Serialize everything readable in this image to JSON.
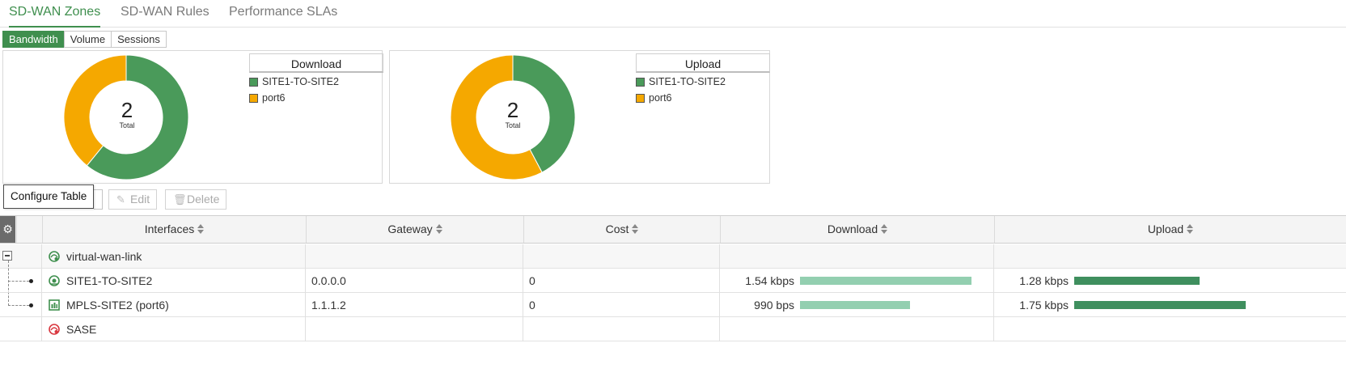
{
  "tabs": [
    {
      "label": "SD-WAN Zones"
    },
    {
      "label": "SD-WAN Rules"
    },
    {
      "label": "Performance SLAs"
    }
  ],
  "modes": [
    {
      "label": "Bandwidth"
    },
    {
      "label": "Volume"
    },
    {
      "label": "Sessions"
    }
  ],
  "colors": {
    "accent": "#3f8f4e",
    "series_green": "#4a9a5a",
    "series_orange": "#f5a800",
    "bar_download": "#93cfb0",
    "bar_upload": "#3f8f5e"
  },
  "charts": {
    "download": {
      "title": "Download",
      "total": "2",
      "total_label": "Total",
      "legend": [
        {
          "name": "SITE1-TO-SITE2",
          "color": "#4a9a5a"
        },
        {
          "name": "port6",
          "color": "#f5a800"
        }
      ]
    },
    "upload": {
      "title": "Upload",
      "total": "2",
      "total_label": "Total",
      "legend": [
        {
          "name": "SITE1-TO-SITE2",
          "color": "#4a9a5a"
        },
        {
          "name": "port6",
          "color": "#f5a800"
        }
      ]
    }
  },
  "chart_data": [
    {
      "type": "pie",
      "title": "Download",
      "categories": [
        "SITE1-TO-SITE2",
        "port6"
      ],
      "values": [
        1.54,
        0.99
      ],
      "units": "kbps"
    },
    {
      "type": "pie",
      "title": "Upload",
      "categories": [
        "SITE1-TO-SITE2",
        "port6"
      ],
      "values": [
        1.28,
        1.75
      ],
      "units": "kbps"
    }
  ],
  "toolbar": {
    "tooltip": "Configure Table",
    "edit_label": "Edit",
    "delete_label": "Delete"
  },
  "table": {
    "columns": {
      "interfaces": "Interfaces",
      "gateway": "Gateway",
      "cost": "Cost",
      "download": "Download",
      "upload": "Upload"
    },
    "group_row": {
      "name": "virtual-wan-link"
    },
    "rows": [
      {
        "name": "SITE1-TO-SITE2",
        "gateway": "0.0.0.0",
        "cost": "0",
        "download": "1.54 kbps",
        "upload": "1.28 kbps",
        "download_fraction": 1.0,
        "upload_fraction": 0.73
      },
      {
        "name": "MPLS-SITE2 (port6)",
        "gateway": "1.1.1.2",
        "cost": "0",
        "download": "990 bps",
        "upload": "1.75 kbps",
        "download_fraction": 0.64,
        "upload_fraction": 1.0
      }
    ],
    "sase_row": {
      "name": "SASE"
    }
  }
}
